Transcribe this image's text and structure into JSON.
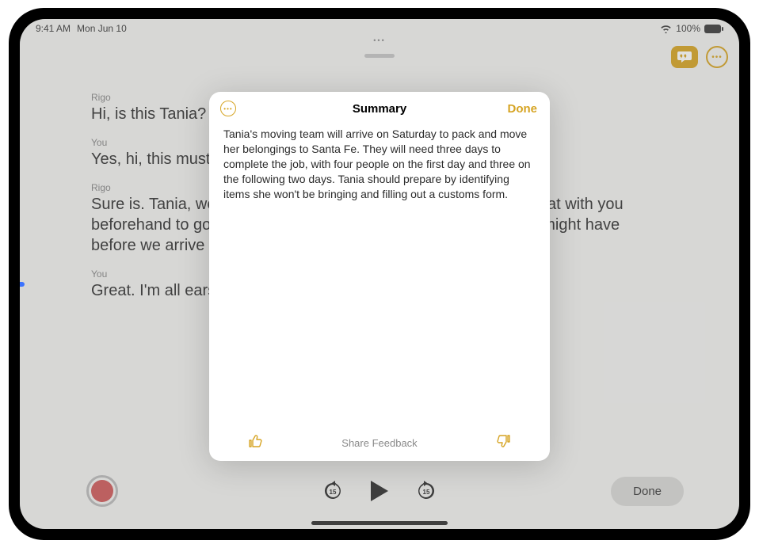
{
  "status": {
    "time": "9:41 AM",
    "date": "Mon Jun 10",
    "battery": "100%"
  },
  "modal": {
    "title": "Summary",
    "done": "Done",
    "body": "Tania's moving team will arrive on Saturday to pack and move her belongings to Santa Fe. They will need three days to complete the job, with four people on the first day and three on the following two days. Tania should prepare by identifying items she won't be bringing and filling out a customs form.",
    "share": "Share Feedback"
  },
  "transcript": [
    {
      "speaker": "Rigo",
      "text": "Hi, is this Tania?"
    },
    {
      "speaker": "You",
      "text": "Yes, hi, this must be Rigo."
    },
    {
      "speaker": "Rigo",
      "text": "Sure is. Tania, we're all set for your move, and I just wanted to chat with you beforehand to go over a few questions and answer any that you might have before we arrive Saturday morning."
    },
    {
      "speaker": "You",
      "text": "Great. I'm all ears."
    }
  ],
  "controls": {
    "back15": "15",
    "fwd15": "15",
    "done": "Done"
  }
}
